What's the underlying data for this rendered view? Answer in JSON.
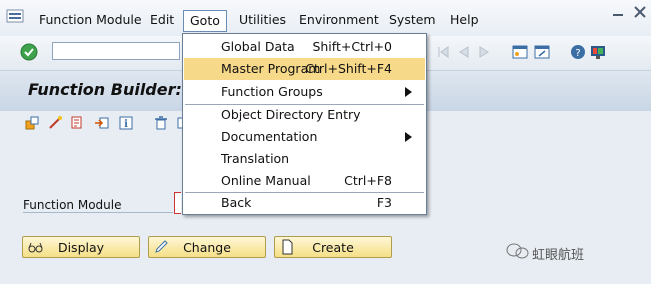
{
  "menubar": {
    "items": [
      {
        "label": "Function Module"
      },
      {
        "label": "Edit"
      },
      {
        "label": "Goto"
      },
      {
        "label": "Utilities"
      },
      {
        "label": "Environment"
      },
      {
        "label": "System"
      },
      {
        "label": "Help"
      }
    ]
  },
  "toolbar": {
    "command_field_value": ""
  },
  "page": {
    "title": "Function Builder: ."
  },
  "form": {
    "function_module_label": "Function Module"
  },
  "buttons": {
    "display": "Display",
    "change": "Change",
    "create": "Create"
  },
  "goto_menu": {
    "items": [
      {
        "label": "Global Data",
        "shortcut": "Shift+Ctrl+0"
      },
      {
        "label": "Master Program",
        "shortcut": "Ctrl+Shift+F4"
      },
      {
        "label": "Function Groups",
        "shortcut": ""
      },
      {
        "label": "Object Directory Entry",
        "shortcut": ""
      },
      {
        "label": "Documentation",
        "shortcut": ""
      },
      {
        "label": "Translation",
        "shortcut": ""
      },
      {
        "label": "Online Manual",
        "shortcut": "Ctrl+F8"
      },
      {
        "label": "Back",
        "shortcut": "F3"
      }
    ]
  },
  "watermark": {
    "text": "虹眼航班"
  },
  "colors": {
    "highlight": "#f7d98a",
    "button_face": "#f5df86",
    "background": "#e7edf3"
  }
}
